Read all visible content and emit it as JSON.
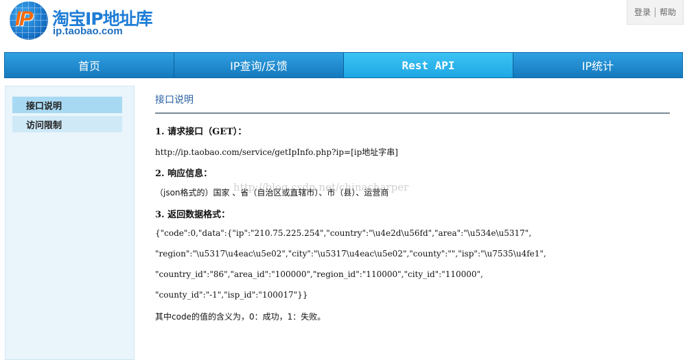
{
  "header": {
    "logo_mark": "IP",
    "title": "淘宝IP地址库",
    "subtitle": "ip.taobao.com",
    "links": [
      "登录",
      "帮助"
    ]
  },
  "nav": {
    "tabs": [
      {
        "label": "首页"
      },
      {
        "label": "IP查询/反馈"
      },
      {
        "label": "Rest API"
      },
      {
        "label": "IP统计"
      }
    ]
  },
  "sidebar": {
    "items": [
      {
        "label": "接口说明"
      },
      {
        "label": "访问限制"
      }
    ]
  },
  "content": {
    "title": "接口说明",
    "sections": [
      {
        "heading": "1. 请求接口（GET）："
      },
      {
        "heading": "2. 响应信息："
      },
      {
        "heading": "3. 返回数据格式："
      }
    ],
    "request_url": "http://ip.taobao.com/service/getIpInfo.php?ip=[ip地址字串]",
    "response_info": "（json格式的）国家 、省（自治区或直辖市）、市（县）、运营商",
    "json_lines": [
      "{\"code\":0,\"data\":{\"ip\":\"210.75.225.254\",\"country\":\"\\u4e2d\\u56fd\",\"area\":\"\\u534e\\u5317\",",
      "\"region\":\"\\u5317\\u4eac\\u5e02\",\"city\":\"\\u5317\\u4eac\\u5e02\",\"county\":\"\",\"isp\":\"\\u7535\\u4fe1\",",
      "\"country_id\":\"86\",\"area_id\":\"100000\",\"region_id\":\"110000\",\"city_id\":\"110000\",",
      "\"county_id\":\"-1\",\"isp_id\":\"100017\"}}"
    ],
    "note": "其中code的值的含义为，0：成功，1：失败。",
    "watermark": "http://blog.csdn.net/chinacharper"
  },
  "colors": {
    "nav_bg": "#1a7fc0",
    "nav_active": "#1ea7e4",
    "sidebar_bg": "#e9f5fb",
    "sidebar_active": "#a8d9f2",
    "content_title": "#2a5fa3"
  }
}
